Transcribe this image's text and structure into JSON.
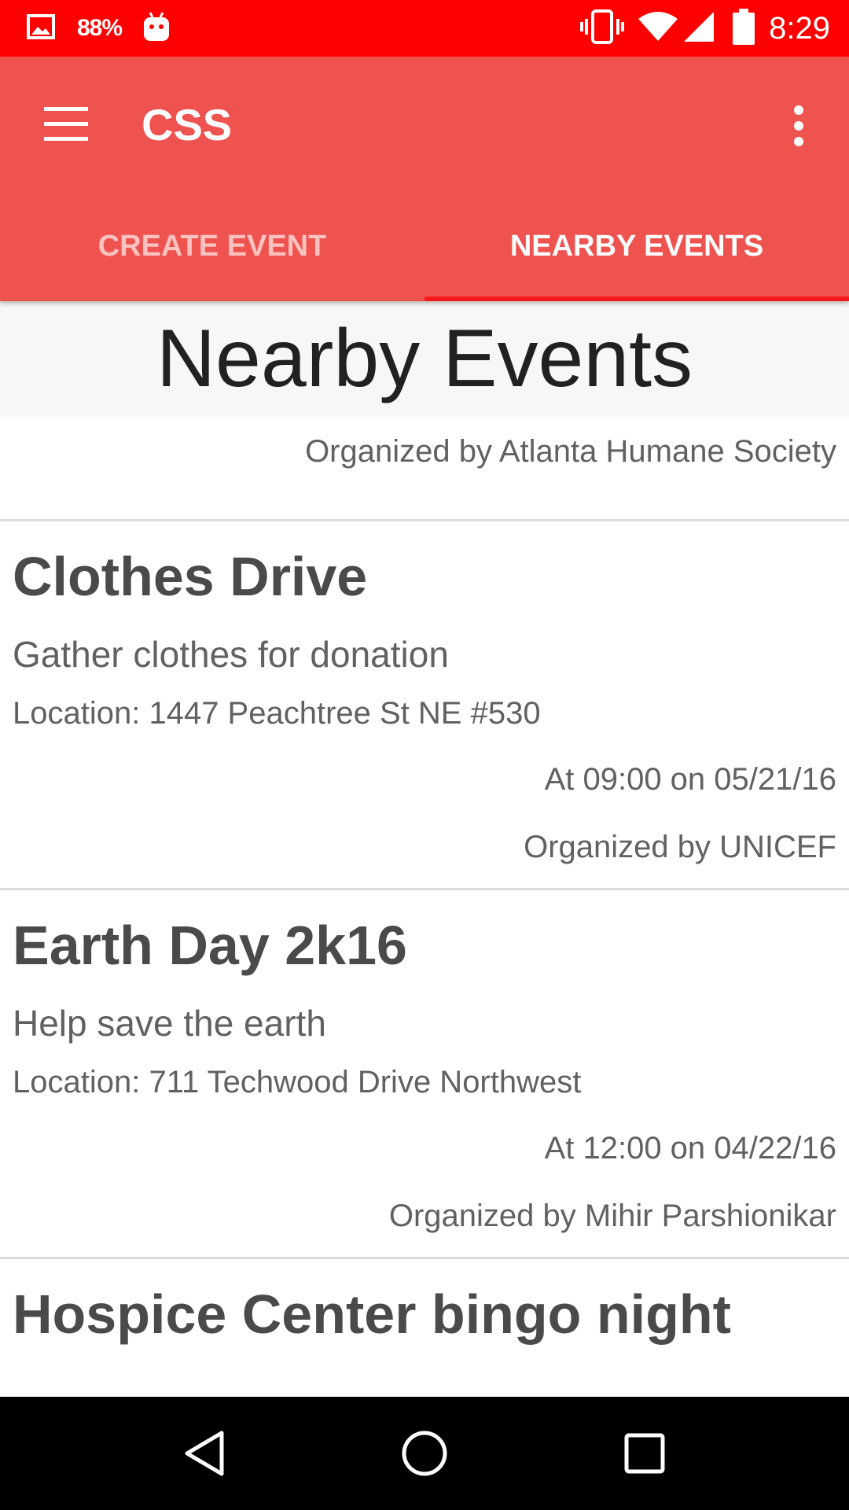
{
  "status_bar": {
    "battery_percent": "88%",
    "clock": "8:29",
    "icons": [
      "image-icon",
      "android-debug-icon",
      "vibrate-icon",
      "wifi-icon",
      "cell-signal-icon",
      "battery-icon"
    ]
  },
  "app_bar": {
    "title": "CSS",
    "background_color": "#ef5350",
    "tabs": [
      {
        "label": "CREATE EVENT",
        "selected": false
      },
      {
        "label": "NEARBY EVENTS",
        "selected": true
      }
    ]
  },
  "main": {
    "heading": "Nearby Events",
    "previous_event_organizer": "Organized by Atlanta Humane Society",
    "events": [
      {
        "title": "Clothes Drive",
        "description": "Gather clothes for donation",
        "location": "Location: 1447 Peachtree St NE #530",
        "time": "At 09:00 on 05/21/16",
        "organizer": "Organized by UNICEF"
      },
      {
        "title": "Earth Day 2k16",
        "description": "Help save the earth",
        "location": "Location: 711 Techwood Drive Northwest",
        "time": "At 12:00 on 04/22/16",
        "organizer": "Organized by Mihir Parshionikar"
      },
      {
        "title": "Hospice Center bingo night"
      }
    ]
  },
  "nav_bar": {
    "buttons": [
      "back-icon",
      "home-icon",
      "recents-icon"
    ]
  }
}
